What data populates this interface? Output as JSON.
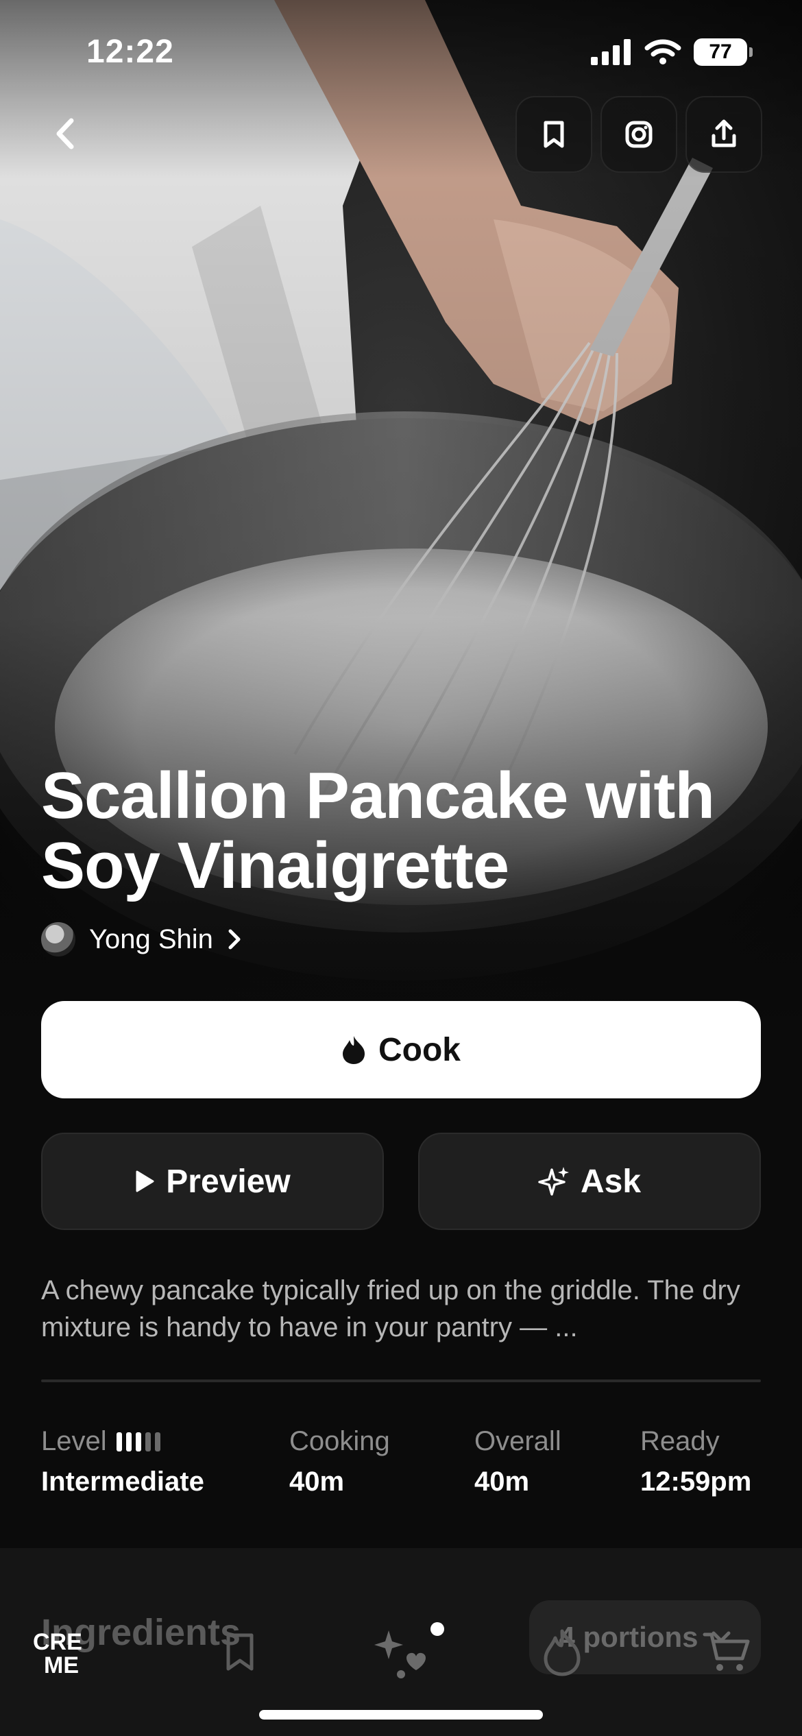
{
  "status_bar": {
    "time": "12:22",
    "battery": "77"
  },
  "hero": {
    "image_alt": "Flour in a mixing bowl being whisked while liquid is poured in"
  },
  "recipe": {
    "title": "Scallion Pancake with Soy Vinaigrette",
    "author": "Yong Shin",
    "description": "A chewy pancake typically fried up on the griddle. The dry mixture is handy to have in your pantry — ..."
  },
  "actions": {
    "cook": "Cook",
    "preview": "Preview",
    "ask": "Ask"
  },
  "stats": {
    "level_label": "Level",
    "level_value": "Intermediate",
    "level_bars": 3,
    "level_bars_total": 5,
    "cooking_label": "Cooking",
    "cooking_value": "40m",
    "overall_label": "Overall",
    "overall_value": "40m",
    "ready_label": "Ready",
    "ready_value": "12:59pm"
  },
  "ingredients": {
    "heading": "Ingredients",
    "portions": "4 portions"
  },
  "tabs": [
    "home-logo",
    "saved",
    "discover",
    "cook",
    "cart"
  ],
  "logo_text": "CRE ME"
}
